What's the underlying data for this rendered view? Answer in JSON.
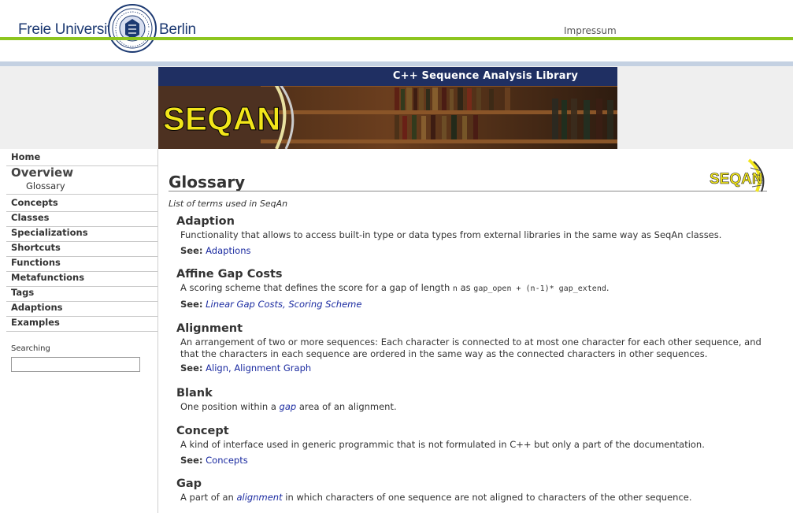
{
  "header": {
    "uni_left": "Freie Universität",
    "uni_right": "Berlin",
    "impressum": "Impressum"
  },
  "banner": {
    "title": "C++ Sequence Analysis Library",
    "logo_text": "SEQAN"
  },
  "sidebar": {
    "items": [
      {
        "label": "Home"
      },
      {
        "label": "Overview"
      },
      {
        "label": "Glossary"
      },
      {
        "label": "Concepts"
      },
      {
        "label": "Classes"
      },
      {
        "label": "Specializations"
      },
      {
        "label": "Shortcuts"
      },
      {
        "label": "Functions"
      },
      {
        "label": "Metafunctions"
      },
      {
        "label": "Tags"
      },
      {
        "label": "Adaptions"
      },
      {
        "label": "Examples"
      }
    ],
    "search_label": "Searching",
    "search_value": ""
  },
  "main": {
    "title": "Glossary",
    "intro": "List of terms used in SeqAn",
    "entries": [
      {
        "term": "Adaption",
        "desc": "Functionality that allows to access built-in type or data types from external libraries in the same way as SeqAn classes.",
        "see_label": "See:",
        "see": [
          "Adaptions"
        ]
      },
      {
        "term": "Affine Gap Costs",
        "desc_a": "A scoring scheme that defines the score for a gap of length",
        "code_n": "n",
        "desc_b": "as",
        "code_formula": "gap_open + (n-1)* gap_extend",
        "desc_c": ".",
        "see_label": "See:",
        "see": [
          "Linear Gap Costs",
          "Scoring Scheme"
        ]
      },
      {
        "term": "Alignment",
        "desc": "An arrangement of two or more sequences: Each character is connected to at most one character for each other sequence, and that the characters in each sequence are ordered in the same way as the connected characters in other sequences.",
        "see_label": "See:",
        "see": [
          "Align",
          "Alignment Graph"
        ]
      },
      {
        "term": "Blank",
        "desc_a": "One position within a",
        "link": "gap",
        "desc_b": "area of an alignment."
      },
      {
        "term": "Concept",
        "desc": "A kind of interface used in generic programmic that is not formulated in C++ but only a part of the documentation.",
        "see_label": "See:",
        "see": [
          "Concepts"
        ]
      },
      {
        "term": "Gap",
        "desc_a": "A part of an",
        "link": "alignment",
        "desc_b": "in which characters of one sequence are not aligned to characters of the other sequence."
      }
    ]
  },
  "colors": {
    "navy": "#1f2f62",
    "green": "#8dc51f",
    "link": "#1a2aa0",
    "logo_yellow": "#f2e61a"
  }
}
